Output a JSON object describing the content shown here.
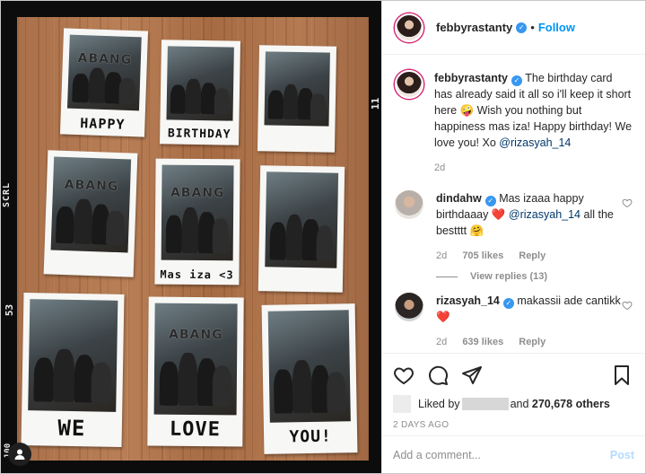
{
  "post": {
    "username": "febbyrastanty",
    "follow_label": "Follow",
    "separator": "•",
    "caption": "The birthday card has already said it all so i'll keep it short here",
    "caption_emoji": "🤪",
    "caption_rest": "Wish you nothing but happiness mas iza! Happy birthday! We love you! Xo",
    "caption_mention": "@rizasyah_14",
    "caption_age": "2d"
  },
  "photo": {
    "film_marks": {
      "scrl": "SCRL",
      "n53": "53",
      "n11": "11",
      "n100": "100"
    },
    "badge_icon": "user-icon",
    "polaroids": [
      {
        "banner": "ABANG",
        "caption": "HAPPY"
      },
      {
        "banner": "",
        "caption": "BIRTHDAY"
      },
      {
        "banner": "",
        "caption": ""
      },
      {
        "banner": "ABANG",
        "caption": ""
      },
      {
        "banner": "ABANG",
        "caption": "Mas iza <3"
      },
      {
        "banner": "",
        "caption": ""
      },
      {
        "banner": "",
        "caption": "WE"
      },
      {
        "banner": "ABANG",
        "caption": "LOVE"
      },
      {
        "banner": "",
        "caption": "YOU!"
      }
    ]
  },
  "comments": [
    {
      "username": "dindahw",
      "text": "Mas izaaa happy birthdaaay",
      "emoji": "❤️",
      "mention": "@rizasyah_14",
      "text_after": "all the bestttt",
      "emoji2": "🤗",
      "age": "2d",
      "likes": "705 likes",
      "reply_label": "Reply",
      "view_replies": "View replies (13)"
    },
    {
      "username": "rizasyah_14",
      "text": "makassii ade cantikk",
      "emoji": "❤️",
      "age": "2d",
      "likes": "639 likes",
      "reply_label": "Reply"
    }
  ],
  "actions": {
    "icons": [
      "heart-icon",
      "comment-icon",
      "share-icon",
      "bookmark-icon"
    ],
    "liked_by_prefix": "Liked by",
    "liked_by_suffix": "and",
    "others_count": "270,678 others",
    "date": "2 DAYS AGO"
  },
  "add_comment": {
    "placeholder": "Add a comment...",
    "post_label": "Post"
  },
  "colors": {
    "link_blue": "#0095f6",
    "mention_blue": "#00376b",
    "verified_blue": "#3897f0",
    "muted_gray": "#8e8e8e",
    "heart_red": "#ed4956"
  }
}
